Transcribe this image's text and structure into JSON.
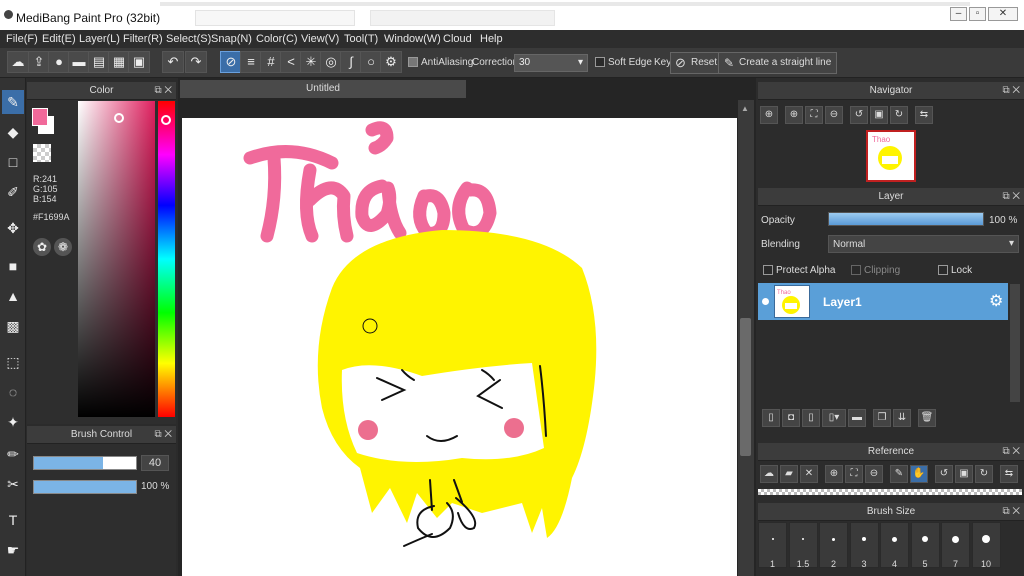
{
  "window": {
    "title": "MediBang Paint Pro (32bit)"
  },
  "menu": [
    "File(F)",
    "Edit(E)",
    "Layer(L)",
    "Filter(R)",
    "Select(S)",
    "Snap(N)",
    "Color(C)",
    "View(V)",
    "Tool(T)",
    "Window(W)",
    "Cloud",
    "Help"
  ],
  "toolbar": {
    "antialiasing_label": "AntiAliasing",
    "correction_label": "Correction",
    "correction_value": "30",
    "soft_edge_label": "Soft Edge",
    "key_label": "Key",
    "reset_label": "Reset",
    "straight_line_label": "Create a straight line"
  },
  "color_panel": {
    "title": "Color",
    "r": "R:241",
    "g": "G:105",
    "b": "B:154",
    "hex": "#F1699A",
    "fg_color": "#F1699A"
  },
  "brush_control": {
    "title": "Brush Control",
    "size_value": "40",
    "opacity_value": "100 %",
    "size_fraction": 0.68,
    "opacity_fraction": 1.0
  },
  "document": {
    "tab_title": "Untitled"
  },
  "navigator": {
    "title": "Navigator"
  },
  "layer_panel": {
    "title": "Layer",
    "opacity_label": "Opacity",
    "opacity_value": "100 %",
    "blending_label": "Blending",
    "blending_value": "Normal",
    "protect_alpha_label": "Protect Alpha",
    "clipping_label": "Clipping",
    "lock_label": "Lock",
    "layers": [
      {
        "name": "Layer1"
      }
    ]
  },
  "reference": {
    "title": "Reference"
  },
  "brush_size": {
    "title": "Brush Size",
    "sizes": [
      "1",
      "1.5",
      "2",
      "3",
      "4",
      "5",
      "7",
      "10"
    ]
  }
}
